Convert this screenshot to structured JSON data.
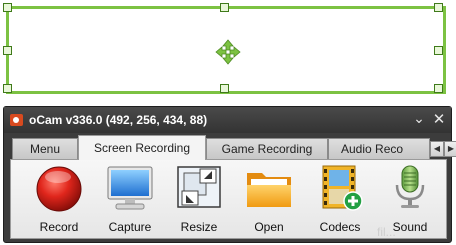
{
  "window": {
    "title": "oCam v336.0 (492, 256, 434, 88)",
    "minimize_symbol": "⌄",
    "close_symbol": "✕"
  },
  "tabs": [
    {
      "label": "Menu",
      "active": false
    },
    {
      "label": "Screen Recording",
      "active": true
    },
    {
      "label": "Game Recording",
      "active": false
    },
    {
      "label": "Audio Reco",
      "active": false
    }
  ],
  "tab_scroll": {
    "left": "◀",
    "right": "▶"
  },
  "toolbar": {
    "items": [
      {
        "label": "Record",
        "icon": "record-icon"
      },
      {
        "label": "Capture",
        "icon": "monitor-icon"
      },
      {
        "label": "Resize",
        "icon": "resize-icon"
      },
      {
        "label": "Open",
        "icon": "folder-icon"
      },
      {
        "label": "Codecs",
        "icon": "film-add-icon"
      },
      {
        "label": "Sound",
        "icon": "microphone-icon"
      }
    ]
  },
  "watermark": "fil...",
  "colors": {
    "region_border": "#7cc242",
    "move_arrows": "#7cc242",
    "titlebar": "#3c3c3c",
    "record_red": "#d8261f"
  }
}
